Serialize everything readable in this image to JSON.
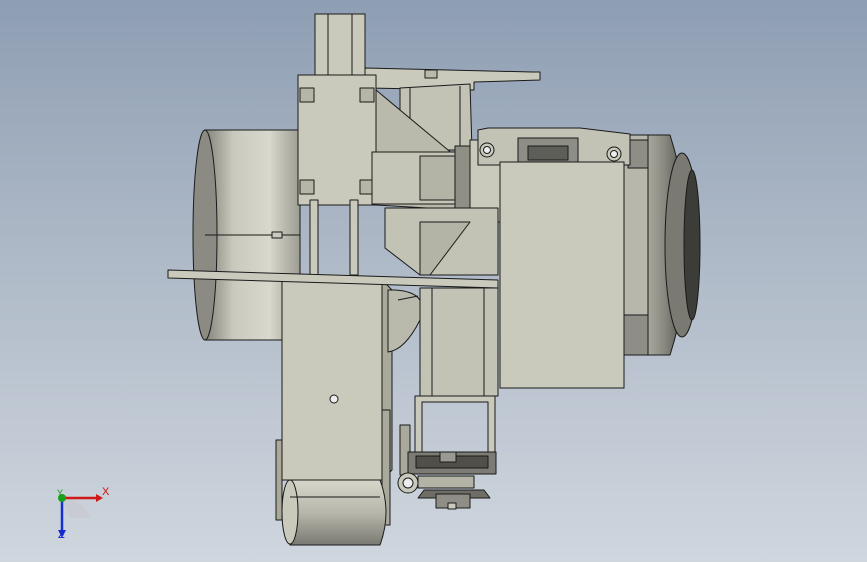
{
  "triad": {
    "x_label": "X",
    "y_label": "Y",
    "z_label": "Z",
    "colors": {
      "x": "#d01818",
      "y": "#18a018",
      "z": "#1830d0"
    }
  },
  "model": {
    "fill": "#c9c9bc",
    "fill_dark": "#a9a99c",
    "edge": "#1a1a1a"
  }
}
